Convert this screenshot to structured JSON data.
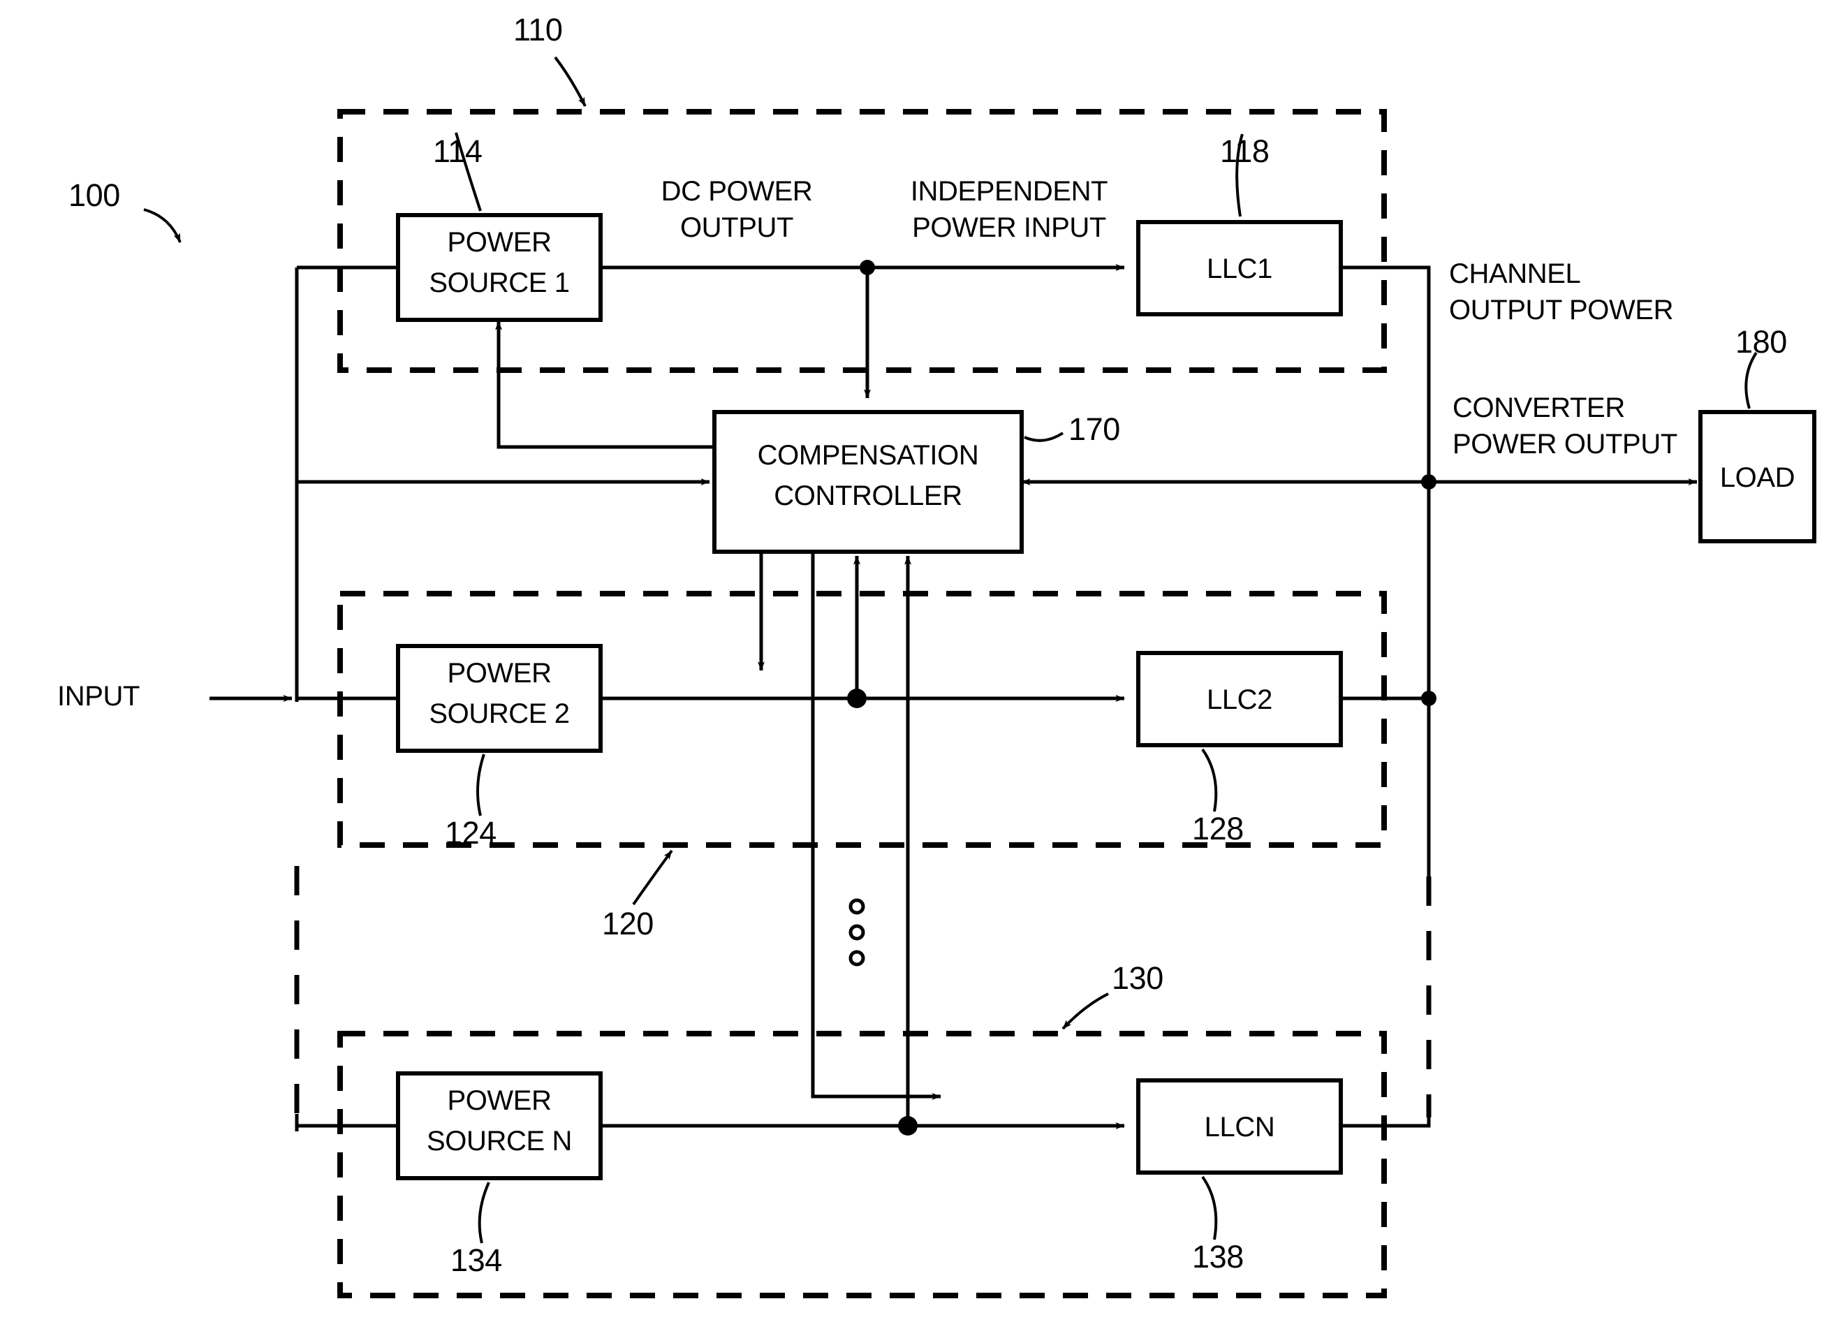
{
  "figure": {
    "type": "patent-block-diagram",
    "title": "Multi-channel power converter with compensation controller",
    "system_ref": "100"
  },
  "reference_numerals": {
    "system": "100",
    "channel_1": "110",
    "power_source_1": "114",
    "llc1": "118",
    "channel_2": "120",
    "power_source_2": "124",
    "llc2": "128",
    "channel_n": "130",
    "power_source_n": "134",
    "llcn": "138",
    "controller": "170",
    "load": "180"
  },
  "blocks": {
    "power_source_1": {
      "line1": "POWER",
      "line2": "SOURCE 1",
      "ref": "114"
    },
    "power_source_2": {
      "line1": "POWER",
      "line2": "SOURCE 2",
      "ref": "124"
    },
    "power_source_n": {
      "line1": "POWER",
      "line2": "SOURCE N",
      "ref": "134"
    },
    "llc1": {
      "label": "LLC1",
      "ref": "118"
    },
    "llc2": {
      "label": "LLC2",
      "ref": "128"
    },
    "llcn": {
      "label": "LLCN",
      "ref": "138"
    },
    "controller": {
      "line1": "COMPENSATION",
      "line2": "CONTROLLER",
      "ref": "170"
    },
    "load": {
      "label": "LOAD",
      "ref": "180"
    }
  },
  "signal_labels": {
    "input": "INPUT",
    "dc_power_output_l1": "DC POWER",
    "dc_power_output_l2": "OUTPUT",
    "independent_power_input_l1": "INDEPENDENT",
    "independent_power_input_l2": "POWER INPUT",
    "channel_output_power_l1": "CHANNEL",
    "channel_output_power_l2": "OUTPUT POWER",
    "converter_power_output_l1": "CONVERTER",
    "converter_power_output_l2": "POWER OUTPUT"
  },
  "channels": [
    {
      "ref": "110",
      "source": "POWER SOURCE 1",
      "source_ref": "114",
      "converter": "LLC1",
      "converter_ref": "118"
    },
    {
      "ref": "120",
      "source": "POWER SOURCE 2",
      "source_ref": "124",
      "converter": "LLC2",
      "converter_ref": "128"
    },
    {
      "ref": "130",
      "source": "POWER SOURCE N",
      "source_ref": "134",
      "converter": "LLCN",
      "converter_ref": "138"
    }
  ],
  "ellipsis": "vertical-three-dots",
  "colors": {
    "stroke": "#000000",
    "background": "#ffffff"
  }
}
